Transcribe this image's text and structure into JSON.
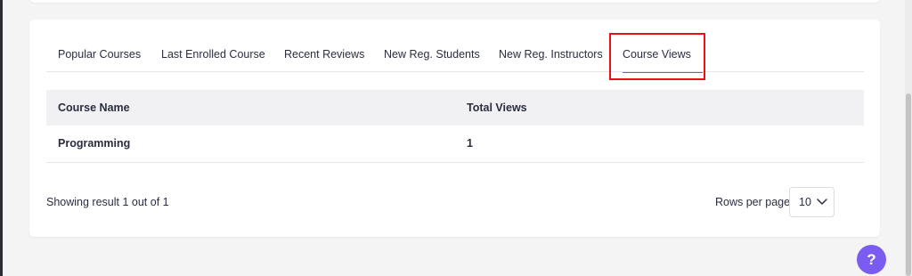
{
  "tabs": [
    {
      "label": "Popular Courses"
    },
    {
      "label": "Last Enrolled Course"
    },
    {
      "label": "Recent Reviews"
    },
    {
      "label": "New Reg. Students"
    },
    {
      "label": "New Reg. Instructors"
    },
    {
      "label": "Course Views",
      "active": true
    }
  ],
  "table": {
    "columns": [
      "Course Name",
      "Total Views"
    ],
    "rows": [
      [
        "Programming",
        "1"
      ]
    ]
  },
  "footer": {
    "summary": "Showing result 1 out of 1",
    "rows_per_page_label": "Rows per page",
    "rows_per_page_value": "10"
  },
  "help": {
    "label": "?"
  },
  "colors": {
    "accent": "#6b5ce7",
    "help_button": "#7b5cf0",
    "highlight": "#e8111b"
  }
}
